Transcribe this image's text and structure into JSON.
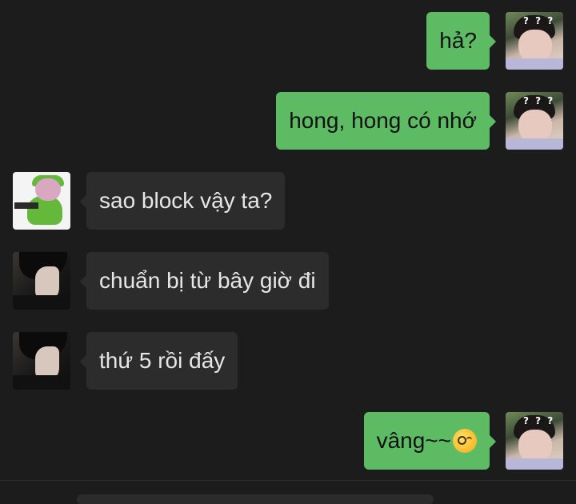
{
  "messages": [
    {
      "side": "out",
      "text": "hả?",
      "avatar": "user-avatar"
    },
    {
      "side": "out",
      "text": "hong, hong có nhớ",
      "avatar": "user-avatar"
    },
    {
      "side": "in",
      "text": "sao block vậy ta?",
      "avatar": "frog-avatar"
    },
    {
      "side": "in",
      "text": "chuẩn bị từ bây giờ đi",
      "avatar": "contact-avatar"
    },
    {
      "side": "in",
      "text": "thứ 5 rồi đấy",
      "avatar": "contact-avatar"
    },
    {
      "side": "out",
      "text": "vâng~~",
      "emoji": "thinking-face-emoji",
      "avatar": "user-avatar"
    }
  ],
  "avatar_overlay_text": "? ? ?",
  "colors": {
    "background": "#1c1c1c",
    "outgoing_bubble": "#5dbb63",
    "incoming_bubble": "#2c2c2c"
  }
}
